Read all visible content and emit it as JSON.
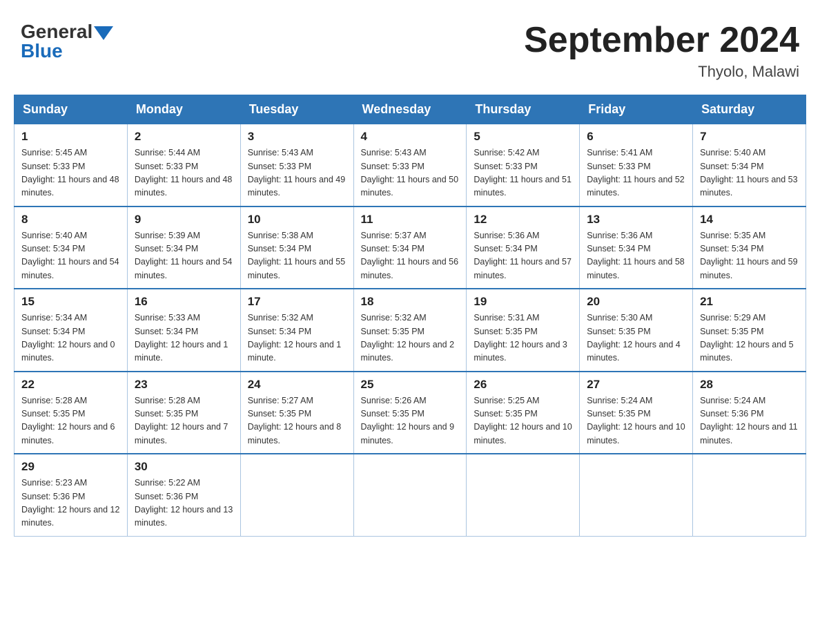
{
  "header": {
    "logo_general": "General",
    "logo_blue": "Blue",
    "title": "September 2024",
    "location": "Thyolo, Malawi"
  },
  "weekdays": [
    "Sunday",
    "Monday",
    "Tuesday",
    "Wednesday",
    "Thursday",
    "Friday",
    "Saturday"
  ],
  "weeks": [
    [
      {
        "day": "1",
        "sunrise": "5:45 AM",
        "sunset": "5:33 PM",
        "daylight": "11 hours and 48 minutes."
      },
      {
        "day": "2",
        "sunrise": "5:44 AM",
        "sunset": "5:33 PM",
        "daylight": "11 hours and 48 minutes."
      },
      {
        "day": "3",
        "sunrise": "5:43 AM",
        "sunset": "5:33 PM",
        "daylight": "11 hours and 49 minutes."
      },
      {
        "day": "4",
        "sunrise": "5:43 AM",
        "sunset": "5:33 PM",
        "daylight": "11 hours and 50 minutes."
      },
      {
        "day": "5",
        "sunrise": "5:42 AM",
        "sunset": "5:33 PM",
        "daylight": "11 hours and 51 minutes."
      },
      {
        "day": "6",
        "sunrise": "5:41 AM",
        "sunset": "5:33 PM",
        "daylight": "11 hours and 52 minutes."
      },
      {
        "day": "7",
        "sunrise": "5:40 AM",
        "sunset": "5:34 PM",
        "daylight": "11 hours and 53 minutes."
      }
    ],
    [
      {
        "day": "8",
        "sunrise": "5:40 AM",
        "sunset": "5:34 PM",
        "daylight": "11 hours and 54 minutes."
      },
      {
        "day": "9",
        "sunrise": "5:39 AM",
        "sunset": "5:34 PM",
        "daylight": "11 hours and 54 minutes."
      },
      {
        "day": "10",
        "sunrise": "5:38 AM",
        "sunset": "5:34 PM",
        "daylight": "11 hours and 55 minutes."
      },
      {
        "day": "11",
        "sunrise": "5:37 AM",
        "sunset": "5:34 PM",
        "daylight": "11 hours and 56 minutes."
      },
      {
        "day": "12",
        "sunrise": "5:36 AM",
        "sunset": "5:34 PM",
        "daylight": "11 hours and 57 minutes."
      },
      {
        "day": "13",
        "sunrise": "5:36 AM",
        "sunset": "5:34 PM",
        "daylight": "11 hours and 58 minutes."
      },
      {
        "day": "14",
        "sunrise": "5:35 AM",
        "sunset": "5:34 PM",
        "daylight": "11 hours and 59 minutes."
      }
    ],
    [
      {
        "day": "15",
        "sunrise": "5:34 AM",
        "sunset": "5:34 PM",
        "daylight": "12 hours and 0 minutes."
      },
      {
        "day": "16",
        "sunrise": "5:33 AM",
        "sunset": "5:34 PM",
        "daylight": "12 hours and 1 minute."
      },
      {
        "day": "17",
        "sunrise": "5:32 AM",
        "sunset": "5:34 PM",
        "daylight": "12 hours and 1 minute."
      },
      {
        "day": "18",
        "sunrise": "5:32 AM",
        "sunset": "5:35 PM",
        "daylight": "12 hours and 2 minutes."
      },
      {
        "day": "19",
        "sunrise": "5:31 AM",
        "sunset": "5:35 PM",
        "daylight": "12 hours and 3 minutes."
      },
      {
        "day": "20",
        "sunrise": "5:30 AM",
        "sunset": "5:35 PM",
        "daylight": "12 hours and 4 minutes."
      },
      {
        "day": "21",
        "sunrise": "5:29 AM",
        "sunset": "5:35 PM",
        "daylight": "12 hours and 5 minutes."
      }
    ],
    [
      {
        "day": "22",
        "sunrise": "5:28 AM",
        "sunset": "5:35 PM",
        "daylight": "12 hours and 6 minutes."
      },
      {
        "day": "23",
        "sunrise": "5:28 AM",
        "sunset": "5:35 PM",
        "daylight": "12 hours and 7 minutes."
      },
      {
        "day": "24",
        "sunrise": "5:27 AM",
        "sunset": "5:35 PM",
        "daylight": "12 hours and 8 minutes."
      },
      {
        "day": "25",
        "sunrise": "5:26 AM",
        "sunset": "5:35 PM",
        "daylight": "12 hours and 9 minutes."
      },
      {
        "day": "26",
        "sunrise": "5:25 AM",
        "sunset": "5:35 PM",
        "daylight": "12 hours and 10 minutes."
      },
      {
        "day": "27",
        "sunrise": "5:24 AM",
        "sunset": "5:35 PM",
        "daylight": "12 hours and 10 minutes."
      },
      {
        "day": "28",
        "sunrise": "5:24 AM",
        "sunset": "5:36 PM",
        "daylight": "12 hours and 11 minutes."
      }
    ],
    [
      {
        "day": "29",
        "sunrise": "5:23 AM",
        "sunset": "5:36 PM",
        "daylight": "12 hours and 12 minutes."
      },
      {
        "day": "30",
        "sunrise": "5:22 AM",
        "sunset": "5:36 PM",
        "daylight": "12 hours and 13 minutes."
      },
      null,
      null,
      null,
      null,
      null
    ]
  ],
  "labels": {
    "sunrise": "Sunrise:",
    "sunset": "Sunset:",
    "daylight": "Daylight:"
  }
}
